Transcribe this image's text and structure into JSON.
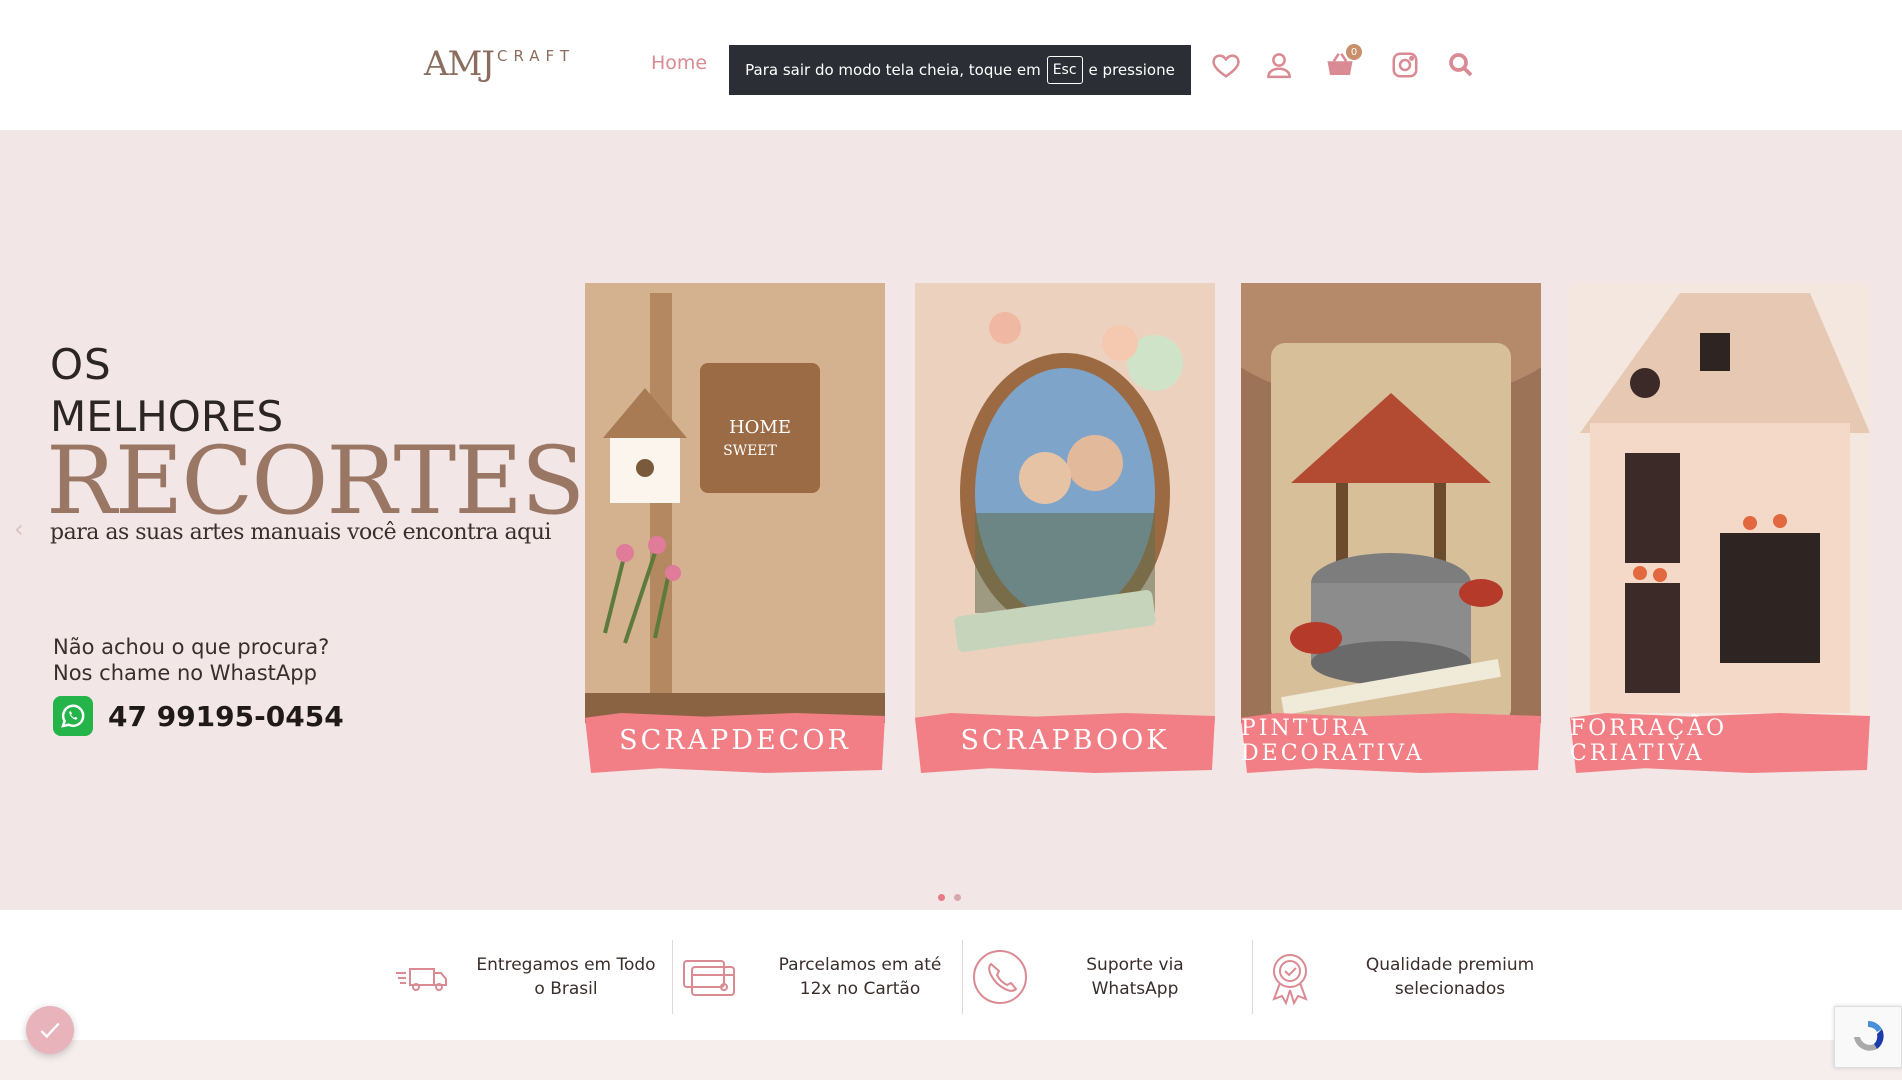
{
  "header": {
    "logo_main": "AMJ",
    "logo_sub": "CRAFT",
    "nav_home": "Home",
    "fullscreen_notice_before": "Para sair do modo tela cheia, toque em",
    "fullscreen_notice_key": "Esc",
    "fullscreen_notice_after": "e pressione",
    "cart_count": "0"
  },
  "hero": {
    "line1": "OS",
    "line2": "MELHORES",
    "line3": "RECORTES",
    "subtitle": "para as suas artes manuais você encontra aqui",
    "contact_q1": "Não achou o que procura?",
    "contact_q2": "Nos chame no WhastApp",
    "phone": "47 99195-0454"
  },
  "categories": [
    {
      "label": "SCRAPDECOR"
    },
    {
      "label": "SCRAPBOOK"
    },
    {
      "label": "PINTURA DECORATIVA"
    },
    {
      "label": "FORRAÇÃO CRIATIVA"
    }
  ],
  "features": [
    {
      "line1": "Entregamos em Todo",
      "line2": "o Brasil",
      "icon": "truck-icon"
    },
    {
      "line1": "Parcelamos em até",
      "line2": "12x no Cartão",
      "icon": "credit-card-icon"
    },
    {
      "line1": "Suporte via WhatsApp",
      "line2": "",
      "icon": "phone-icon"
    },
    {
      "line1": "Qualidade premium",
      "line2": "selecionados",
      "icon": "badge-icon"
    }
  ],
  "colors": {
    "accent": "#d98a92",
    "hero_bg": "#f2e6e6",
    "label_bg": "#f17f85",
    "brand_brown": "#9a7665"
  }
}
